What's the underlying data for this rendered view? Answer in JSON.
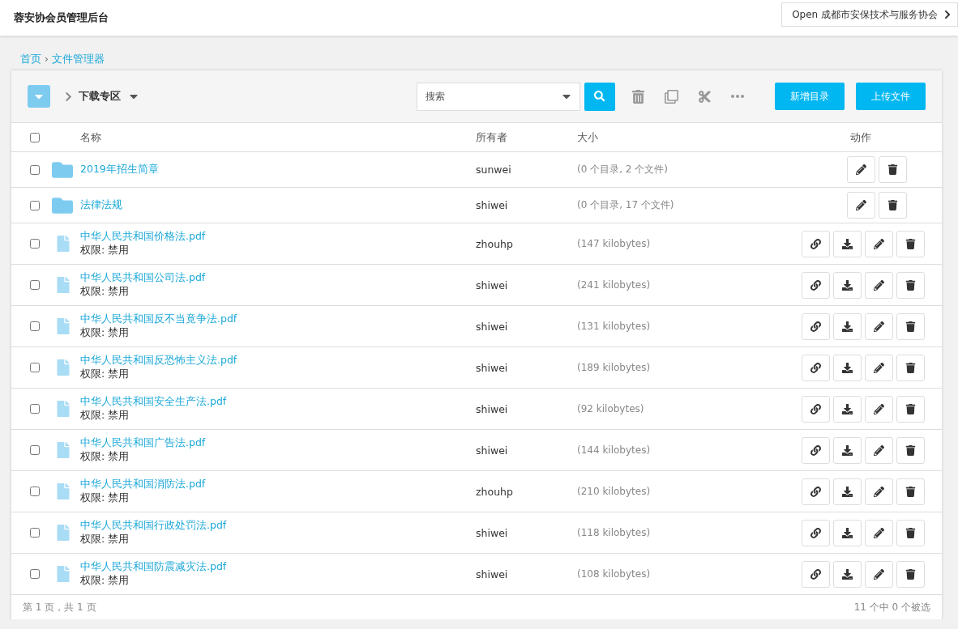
{
  "header": {
    "title": "蓉安协会员管理后台",
    "org_button": "Open 成都市安保技术与服务协会"
  },
  "breadcrumb": [
    {
      "label": "首页"
    },
    {
      "separator": "›",
      "label": "文件管理器"
    }
  ],
  "toolbar": {
    "folder": "下载专区",
    "search": {
      "placeholder": "搜索"
    },
    "buttons": [
      "新增目录",
      "上传文件"
    ]
  },
  "table": {
    "select_all": {
      "checked": false
    },
    "columns": [
      "名称",
      "所有者",
      "大小",
      "动作"
    ],
    "rows": [
      {
        "kind": "folder",
        "name": "2019年招生简章",
        "owner": "sunwei",
        "size": "(0 个目录, 2 个文件)",
        "checked": false
      },
      {
        "kind": "folder",
        "name": "法律法规",
        "owner": "shiwei",
        "size": "(0 个目录, 17 个文件)",
        "checked": false
      },
      {
        "kind": "file",
        "name": "中华人民共和国价格法.pdf",
        "permission": "权限: 禁用",
        "owner": "zhouhp",
        "size": "(147 kilobytes)",
        "checked": false
      },
      {
        "kind": "file",
        "name": "中华人民共和国公司法.pdf",
        "permission": "权限: 禁用",
        "owner": "shiwei",
        "size": "(241 kilobytes)",
        "checked": false
      },
      {
        "kind": "file",
        "name": "中华人民共和国反不当竟争法.pdf",
        "permission": "权限: 禁用",
        "owner": "shiwei",
        "size": "(131 kilobytes)",
        "checked": false
      },
      {
        "kind": "file",
        "name": "中华人民共和国反恐怖主义法.pdf",
        "permission": "权限: 禁用",
        "owner": "shiwei",
        "size": "(189 kilobytes)",
        "checked": false
      },
      {
        "kind": "file",
        "name": "中华人民共和国安全生产法.pdf",
        "permission": "权限: 禁用",
        "owner": "shiwei",
        "size": "(92 kilobytes)",
        "checked": false
      },
      {
        "kind": "file",
        "name": "中华人民共和国广告法.pdf",
        "permission": "权限: 禁用",
        "owner": "shiwei",
        "size": "(144 kilobytes)",
        "checked": false
      },
      {
        "kind": "file",
        "name": "中华人民共和国消防法.pdf",
        "permission": "权限: 禁用",
        "owner": "zhouhp",
        "size": "(210 kilobytes)",
        "checked": false
      },
      {
        "kind": "file",
        "name": "中华人民共和国行政处罚法.pdf",
        "permission": "权限: 禁用",
        "owner": "shiwei",
        "size": "(118 kilobytes)",
        "checked": false
      },
      {
        "kind": "file",
        "name": "中华人民共和国防震减灾法.pdf",
        "permission": "权限: 禁用",
        "owner": "shiwei",
        "size": "(108 kilobytes)",
        "checked": false
      }
    ]
  },
  "footer": {
    "pages": "第 1 页，共 1 页",
    "selection": "11 个中 0 个被选"
  }
}
